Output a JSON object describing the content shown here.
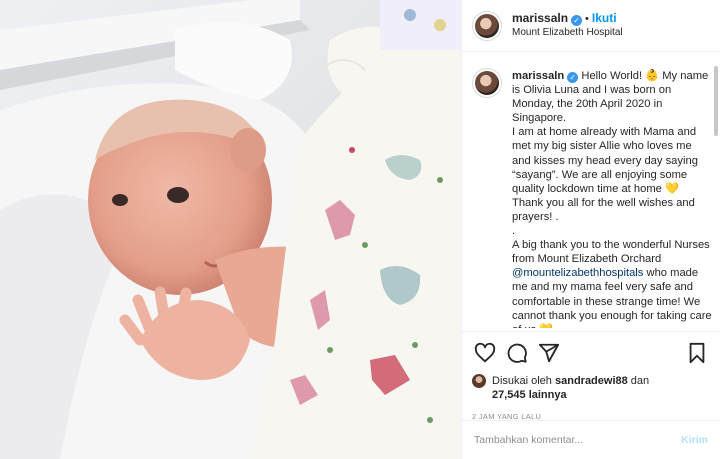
{
  "post": {
    "username": "marissaln",
    "follow_label": "Ikuti",
    "dot": "•",
    "location": "Mount Elizabeth Hospital"
  },
  "caption": {
    "username": "marissaln",
    "text": "Hello World! 👶 My name is Olivia Luna and I was born on Monday, the 20th April 2020 in Singapore.\nI am at home already with Mama and met my big sister Allie who loves me and kisses my head every day saying “sayang”. We are all enjoying some quality lockdown time at home 💛 Thank you all for the well wishes and prayers! .\n.\nA big thank you to the wonderful Nurses from Mount Elizabeth Orchard ",
    "mention": "@mountelizabethhospitals",
    "text_after": " who made me and my mama feel very safe and comfortable in these strange time! We cannot thank you enough for taking care of us 💛"
  },
  "likes": {
    "prefix": "Disukai oleh ",
    "liker": "sandradewi88",
    "middle": " dan",
    "count": "27,545 lainnya"
  },
  "timestamp": "2 JAM YANG LALU",
  "comment": {
    "placeholder": "Tambahkan komentar...",
    "send_label": "Kirim"
  },
  "colors": {
    "accent": "#0095f6",
    "verified": "#3897f0",
    "send_disabled": "#b2dffc"
  },
  "icons": [
    "heart-icon",
    "comment-icon",
    "share-icon",
    "bookmark-icon",
    "verified-icon"
  ]
}
